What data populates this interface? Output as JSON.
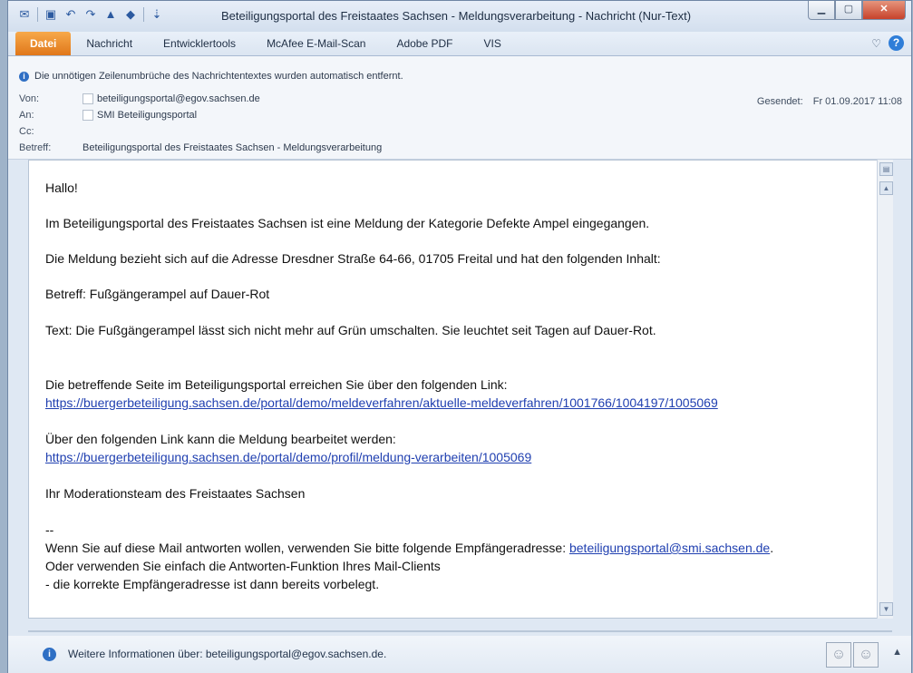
{
  "window": {
    "title": "Beteiligungsportal des Freistaates Sachsen - Meldungsverarbeitung  -  Nachricht (Nur-Text)"
  },
  "ribbon": {
    "tabs": [
      "Datei",
      "Nachricht",
      "Entwicklertools",
      "McAfee E-Mail-Scan",
      "Adobe PDF",
      "VIS"
    ]
  },
  "header": {
    "info_bar": "Die unnötigen Zeilenumbrüche des Nachrichtentextes wurden automatisch entfernt.",
    "from_label": "Von:",
    "from_value": "beteiligungsportal@egov.sachsen.de",
    "to_label": "An:",
    "to_value": "SMI Beteiligungsportal",
    "cc_label": "Cc:",
    "subject_label": "Betreff:",
    "subject_value": "Beteiligungsportal des Freistaates Sachsen - Meldungsverarbeitung",
    "sent_label": "Gesendet:",
    "sent_value": "Fr 01.09.2017 11:08"
  },
  "body": {
    "greeting": "Hallo!",
    "line1": "Im Beteiligungsportal des Freistaates Sachsen ist eine Meldung der Kategorie Defekte Ampel eingegangen.",
    "line2": "Die Meldung bezieht sich auf die Adresse Dresdner Straße 64-66, 01705 Freital und hat den folgenden Inhalt:",
    "line3": "Betreff: Fußgängerampel auf Dauer-Rot",
    "line4": "Text: Die Fußgängerampel lässt sich nicht mehr auf Grün umschalten. Sie leuchtet seit Tagen auf Dauer-Rot.",
    "line5": "Die betreffende Seite im Beteiligungsportal erreichen Sie über den folgenden Link:",
    "link1": "https://buergerbeteiligung.sachsen.de/portal/demo/meldeverfahren/aktuelle-meldeverfahren/1001766/1004197/1005069",
    "line6": "Über den folgenden Link kann die Meldung bearbeitet werden:",
    "link2": "https://buergerbeteiligung.sachsen.de/portal/demo/profil/meldung-verarbeiten/1005069",
    "line7": "Ihr Moderationsteam des Freistaates Sachsen",
    "sig_dash": "--",
    "line8_prefix": "Wenn Sie auf diese Mail antworten wollen, verwenden Sie bitte folgende Empfängeradresse: ",
    "line8_link": "beteiligungsportal@smi.sachsen.de",
    "line8_suffix": ".",
    "line9": "Oder verwenden Sie einfach die Antworten-Funktion Ihres Mail-Clients",
    "line10": "- die korrekte Empfängeradresse ist dann bereits vorbelegt."
  },
  "footer": {
    "text": "Weitere Informationen über: beteiligungsportal@egov.sachsen.de."
  },
  "icons": [
    "mail-icon",
    "save-icon",
    "undo-icon",
    "redo-icon",
    "up-arrow-icon",
    "down-arrow-icon",
    "customize-qat-icon",
    "info-icon",
    "avatar-icon",
    "help-icon"
  ]
}
